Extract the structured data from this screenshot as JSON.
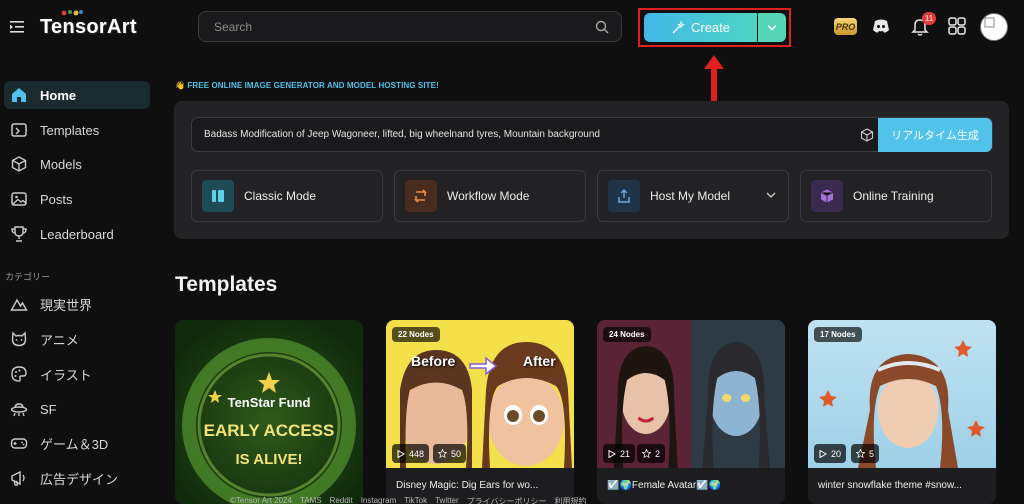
{
  "header": {
    "logo_text": "TensorArt",
    "search_placeholder": "Search",
    "create_label": "Create",
    "pro_label": "PRO",
    "notification_count": "11"
  },
  "sidebar": {
    "items": [
      {
        "label": "Home",
        "icon": "home-icon"
      },
      {
        "label": "Templates",
        "icon": "templates-icon"
      },
      {
        "label": "Models",
        "icon": "cube-icon"
      },
      {
        "label": "Posts",
        "icon": "image-icon"
      },
      {
        "label": "Leaderboard",
        "icon": "trophy-icon"
      }
    ],
    "category_heading": "カテゴリー",
    "categories": [
      {
        "label": "現実世界",
        "icon": "mountain-icon"
      },
      {
        "label": "アニメ",
        "icon": "cat-face-icon"
      },
      {
        "label": "イラスト",
        "icon": "palette-icon"
      },
      {
        "label": "SF",
        "icon": "ufo-icon"
      },
      {
        "label": "ゲーム＆3D",
        "icon": "gamepad-icon"
      },
      {
        "label": "広告デザイン",
        "icon": "ad-icon"
      }
    ]
  },
  "main": {
    "tagline": "FREE ONLINE IMAGE GENERATOR AND MODEL HOSTING SITE!",
    "prompt_text": "Badass Modification of Jeep Wagoneer, lifted, big wheelnand tyres, Mountain background",
    "generate_label": "リアルタイム生成",
    "modes": [
      {
        "label": "Classic Mode"
      },
      {
        "label": "Workflow Mode"
      },
      {
        "label": "Host My Model"
      },
      {
        "label": "Online Training"
      }
    ],
    "section_title": "Templates",
    "cards": [
      {
        "nodes": "",
        "runs": "",
        "likes": "",
        "title": "",
        "promo_line1": "TenStar Fund",
        "promo_line2": "EARLY ACCESS",
        "promo_line3": "IS ALIVE!"
      },
      {
        "nodes": "22 Nodes",
        "runs": "448",
        "likes": "50",
        "title": "Disney Magic: Dig Ears for wo...",
        "before": "Before",
        "after": "After"
      },
      {
        "nodes": "24 Nodes",
        "runs": "21",
        "likes": "2",
        "title": "☑️🌍Female Avatar☑️🌍"
      },
      {
        "nodes": "17 Nodes",
        "runs": "20",
        "likes": "5",
        "title": "winter snowflake theme #snow..."
      }
    ]
  },
  "footer": {
    "items": [
      "©Tensor Art 2024",
      "TAMS",
      "Reddit",
      "Instagram",
      "TikTok",
      "Twitter",
      "プライバシーポリシー",
      "利用規約"
    ]
  },
  "colors": {
    "accent": "#51c3ea",
    "create_gradient_start": "#43b7e8",
    "create_gradient_end": "#4fd4c4",
    "highlight_border": "#e02020"
  }
}
